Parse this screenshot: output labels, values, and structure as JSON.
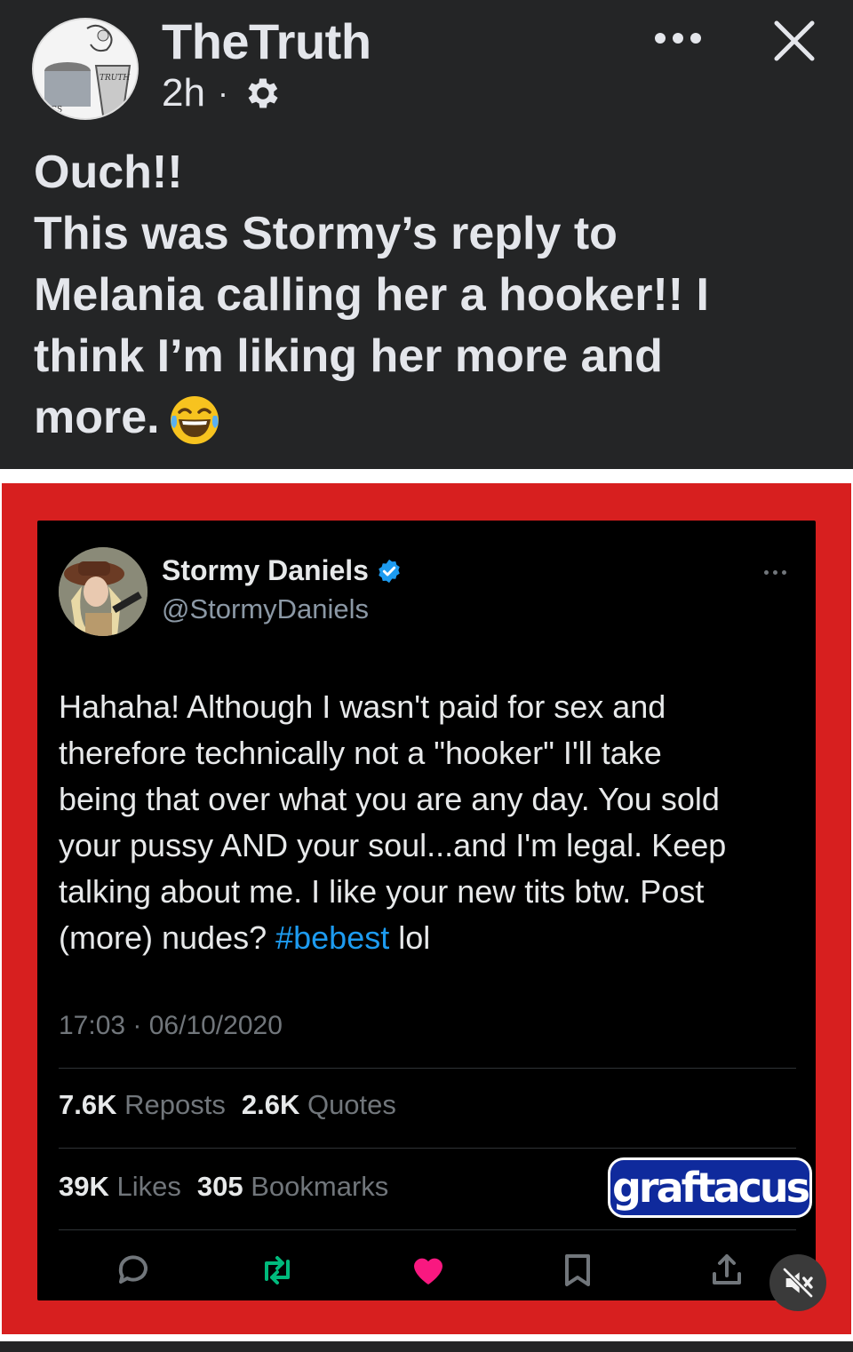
{
  "post": {
    "author": "TheTruth",
    "time": "2h",
    "separator": "·",
    "avatar_text_top": "TRUTH",
    "avatar_text_bottom": "ITICS",
    "lines": [
      "Ouch!!",
      "This was Stormy’s reply to",
      "Melania calling her a hooker!! I",
      "think I’m liking her more and",
      "more."
    ]
  },
  "icons": {
    "more": "more-horizontal-icon",
    "close": "close-icon",
    "privacy": "gear-icon",
    "emoji": "laughing-tears-emoji",
    "verified": "verified-badge-icon",
    "reply": "reply-icon",
    "repost": "repost-icon",
    "like": "heart-icon",
    "bookmark": "bookmark-icon",
    "share": "share-icon",
    "mute": "muted-speaker-icon"
  },
  "tweet": {
    "name": "Stormy Daniels",
    "handle": "@StormyDaniels",
    "body_lines": [
      "Hahaha! Although I wasn't paid for sex and",
      "therefore technically not a \"hooker\" I'll take",
      "being that over what you are any day. You sold",
      "your pussy AND your soul...and I'm legal. Keep",
      "talking about me. I like your new tits btw. Post"
    ],
    "last_line_before": "(more) nudes? ",
    "hashtag": "#bebest",
    "last_line_after": " lol",
    "timestamp": "17:03 · 06/10/2020",
    "stats_row1": [
      {
        "value": "7.6K",
        "label": "Reposts"
      },
      {
        "value": "2.6K",
        "label": "Quotes"
      }
    ],
    "stats_row2": [
      {
        "value": "39K",
        "label": "Likes"
      },
      {
        "value": "305",
        "label": "Bookmarks"
      }
    ]
  },
  "watermark": "graftacus",
  "colors": {
    "background": "#242526",
    "frame_red": "#d71f1f",
    "tweet_bg": "#000000",
    "hashtag": "#1d9bf0",
    "repost": "#00ba7c",
    "like": "#f91880",
    "watermark_bg": "#0f2a9c"
  }
}
